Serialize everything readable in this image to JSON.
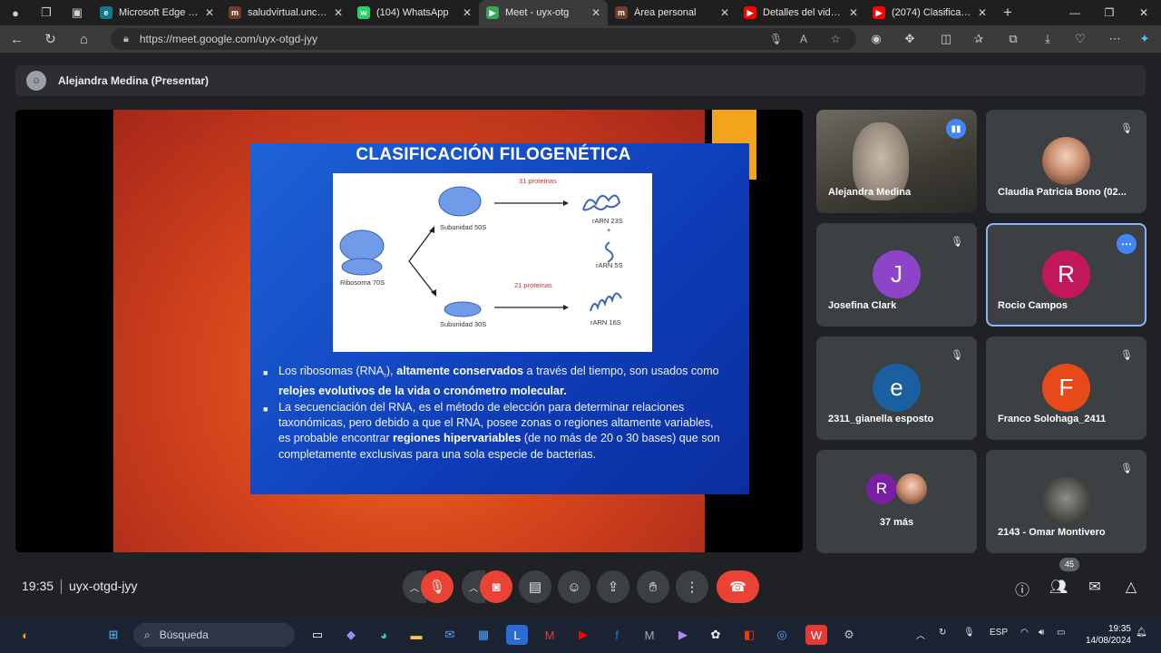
{
  "browser": {
    "tabs": [
      {
        "title": "Microsoft Edge | Ne",
        "favicon_color": "#0f7a8c",
        "favicon_glyph": "e",
        "active": false
      },
      {
        "title": "saludvirtual.unca.ed",
        "favicon_color": "#6b3f2a",
        "favicon_glyph": "m",
        "active": false
      },
      {
        "title": "(104) WhatsApp",
        "favicon_color": "#25d366",
        "favicon_glyph": "w",
        "active": false
      },
      {
        "title": "Meet - uyx-otg",
        "favicon_color": "#34a853",
        "favicon_glyph": "▶",
        "active": true
      },
      {
        "title": "Área personal",
        "favicon_color": "#6b3f2a",
        "favicon_glyph": "m",
        "active": false
      },
      {
        "title": "Detalles del video -",
        "favicon_color": "#ff0000",
        "favicon_glyph": "▶",
        "active": false
      },
      {
        "title": "(2074) Clasificación",
        "favicon_color": "#ff0000",
        "favicon_glyph": "▶",
        "active": false
      }
    ],
    "url": "https://meet.google.com/uyx-otgd-jyy"
  },
  "meet": {
    "presenter_label": "Alejandra Medina (Presentar)",
    "slide": {
      "title": "CLASIFICACIÓN FILOGENÉTICA",
      "figure": {
        "ribosome": "Ribosoma 70S",
        "sub50": "Subunidad 50S",
        "sub30": "Subunidad 30S",
        "prot31": "31 proteínas",
        "prot21": "21 proteínas",
        "rarn23": "rARN 23S",
        "plus": "+",
        "rarn5": "rARN 5S",
        "rarn16": "rARN 16S"
      },
      "bullet1": {
        "t1": "Los ribosomas (RNA",
        "sub": "r",
        "t2": "), ",
        "b1": "altamente conservados",
        "t3": " a través del tiempo, son usados como ",
        "b2": "relojes evolutivos de la vida o cronómetro molecular."
      },
      "bullet2": {
        "t1": "La secuenciación del RNA, es el método de elección para determinar relaciones taxonómicas, pero debido a que el RNA, posee zonas o regiones altamente variables, es probable encontrar ",
        "b1": "regiones hipervariables",
        "t2": " (de no más de 20 o 30 bases) que son completamente exclusivas para una sola especie de bacterias."
      }
    },
    "participants": {
      "alejandra": "Alejandra Medina",
      "claudia": "Claudia Patricia Bono (02...",
      "josefina": "Josefina Clark",
      "josefina_initial": "J",
      "rocio": "Rocio Campos",
      "rocio_initial": "R",
      "gianella": "2311_gianella esposto",
      "gianella_initial": "e",
      "franco": "Franco Solohaga_2411",
      "franco_initial": "F",
      "others": "37 más",
      "others_initial": "R",
      "omar": "2143 - Omar Montivero"
    },
    "colors": {
      "josefina": "#8e44c8",
      "rocio": "#c2185b",
      "gianella": "#1a5fa0",
      "franco": "#e64a19",
      "others": "#7b1fa2",
      "leave": "#ea4335",
      "accent": "#4285f4"
    },
    "controls": {
      "time": "19:35",
      "meeting_code": "uyx-otgd-jyy",
      "participant_count": "45"
    }
  },
  "taskbar": {
    "search_placeholder": "Búsqueda",
    "language": "ESP",
    "time": "19:35",
    "date": "14/08/2024"
  }
}
